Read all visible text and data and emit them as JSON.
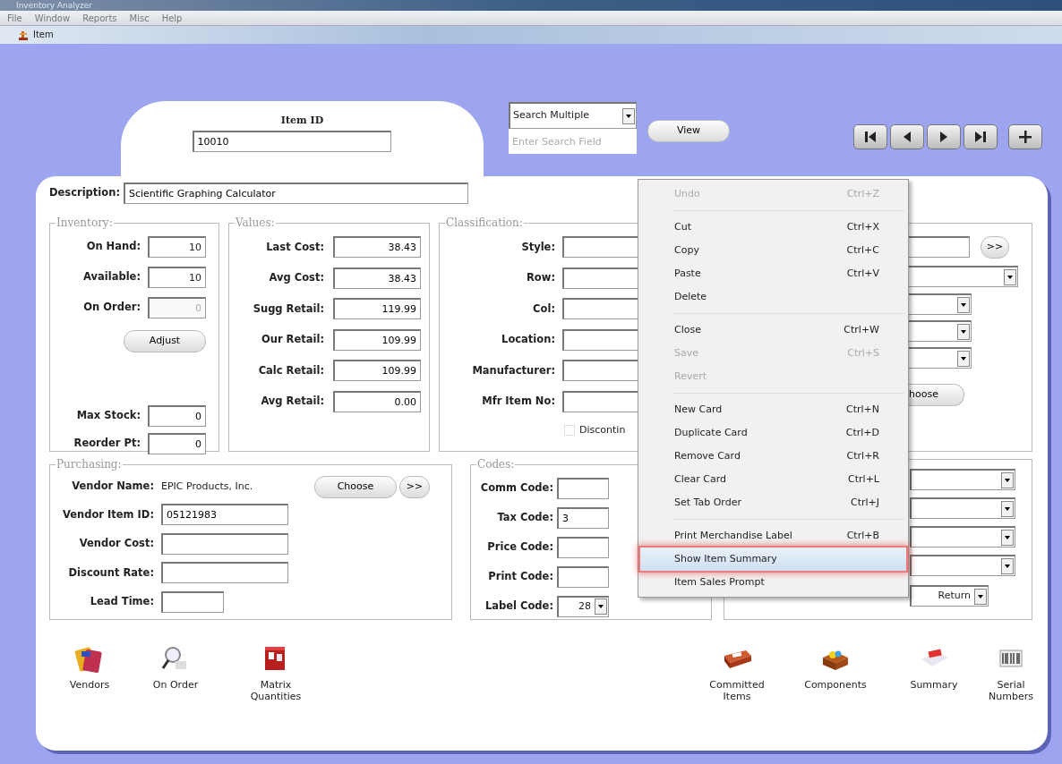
{
  "app_window": {
    "title": "Inventory Analyzer"
  },
  "menu_bar": [
    "File",
    "Window",
    "Reports",
    "Misc",
    "Help"
  ],
  "item_window": {
    "title": "Item"
  },
  "item_id": {
    "label": "Item ID",
    "value": "10010"
  },
  "search": {
    "mode": "Search Multiple",
    "placeholder": "Enter Search Field",
    "view_button": "View"
  },
  "description": {
    "label": "Description:",
    "value": "Scientific Graphing Calculator"
  },
  "inventory": {
    "title": "Inventory:",
    "fields": [
      {
        "label": "On Hand:",
        "value": "10",
        "disabled": false
      },
      {
        "label": "Available:",
        "value": "10",
        "disabled": false
      },
      {
        "label": "On Order:",
        "value": "0",
        "disabled": true
      }
    ],
    "adjust_button": "Adjust",
    "limits": [
      {
        "label": "Max Stock:",
        "value": "0"
      },
      {
        "label": "Reorder Pt:",
        "value": "0"
      }
    ]
  },
  "values": {
    "title": "Values:",
    "fields": [
      {
        "label": "Last Cost:",
        "value": "38.43"
      },
      {
        "label": "Avg Cost:",
        "value": "38.43"
      },
      {
        "label": "Sugg Retail:",
        "value": "119.99"
      },
      {
        "label": "Our Retail:",
        "value": "109.99"
      },
      {
        "label": "Calc Retail:",
        "value": "109.99"
      },
      {
        "label": "Avg Retail:",
        "value": "0.00"
      }
    ]
  },
  "classification": {
    "title": "Classification:",
    "fields": [
      {
        "label": "Style:"
      },
      {
        "label": "Row:"
      },
      {
        "label": "Col:"
      },
      {
        "label": "Location:"
      },
      {
        "label": "Manufacturer:"
      },
      {
        "label": "Mfr Item No:"
      }
    ],
    "discontinued": {
      "label": "Discontin",
      "checked": false
    },
    "side_controls": [
      {
        "kind": "text_more",
        "more_label": ">>"
      },
      {
        "kind": "select_wide"
      },
      {
        "kind": "select"
      },
      {
        "kind": "select"
      },
      {
        "kind": "select"
      },
      {
        "kind": "button",
        "label": "hoose"
      }
    ]
  },
  "purchasing": {
    "title": "Purchasing:",
    "vendor_name": {
      "label": "Vendor Name:",
      "value": "EPIC Products, Inc."
    },
    "choose_button": "Choose",
    "more_button": ">>",
    "fields": [
      {
        "label": "Vendor Item ID:",
        "value": "05121983",
        "kind": "text"
      },
      {
        "label": "Vendor Cost:",
        "kind": "text"
      },
      {
        "label": "Discount Rate:",
        "kind": "text"
      },
      {
        "label": "Lead Time:",
        "kind": "short"
      }
    ]
  },
  "codes": {
    "title": "Codes:",
    "fields": [
      {
        "label": "Comm Code:",
        "kind": "text"
      },
      {
        "label": "Tax Code:",
        "kind": "text",
        "value": "3"
      },
      {
        "label": "Price Code:",
        "kind": "text"
      },
      {
        "label": "Print Code:",
        "kind": "text"
      },
      {
        "label": "Label Code:",
        "kind": "select",
        "value": "28"
      }
    ]
  },
  "options": {
    "dropdowns": [
      {
        "kind": "select"
      },
      {
        "kind": "select"
      },
      {
        "kind": "select"
      },
      {
        "kind": "select"
      }
    ],
    "trans_code_value": "Return"
  },
  "tools_left": [
    {
      "label": "Vendors"
    },
    {
      "label": "On Order"
    },
    {
      "label": "Matrix Quantities"
    }
  ],
  "tools_right": [
    {
      "label": "Committed Items"
    },
    {
      "label": "Components"
    },
    {
      "label": "Summary"
    },
    {
      "label": "Serial Numbers"
    }
  ],
  "context_menu": {
    "items": [
      {
        "kind": "item",
        "label": "Undo",
        "shortcut": "Ctrl+Z",
        "disabled": true,
        "selected": false
      },
      {
        "kind": "separator"
      },
      {
        "kind": "item",
        "label": "Cut",
        "shortcut": "Ctrl+X",
        "disabled": false,
        "selected": false
      },
      {
        "kind": "item",
        "label": "Copy",
        "shortcut": "Ctrl+C",
        "disabled": false,
        "selected": false
      },
      {
        "kind": "item",
        "label": "Paste",
        "shortcut": "Ctrl+V",
        "disabled": false,
        "selected": false
      },
      {
        "kind": "item",
        "label": "Delete",
        "disabled": false,
        "selected": false
      },
      {
        "kind": "separator"
      },
      {
        "kind": "item",
        "label": "Close",
        "shortcut": "Ctrl+W",
        "disabled": false,
        "selected": false
      },
      {
        "kind": "item",
        "label": "Save",
        "shortcut": "Ctrl+S",
        "disabled": true,
        "selected": false
      },
      {
        "kind": "item",
        "label": "Revert",
        "disabled": true,
        "selected": false
      },
      {
        "kind": "separator"
      },
      {
        "kind": "item",
        "label": "New Card",
        "shortcut": "Ctrl+N",
        "disabled": false,
        "selected": false
      },
      {
        "kind": "item",
        "label": "Duplicate Card",
        "shortcut": "Ctrl+D",
        "disabled": false,
        "selected": false
      },
      {
        "kind": "item",
        "label": "Remove Card",
        "shortcut": "Ctrl+R",
        "disabled": false,
        "selected": false
      },
      {
        "kind": "item",
        "label": "Clear Card",
        "shortcut": "Ctrl+L",
        "disabled": false,
        "selected": false
      },
      {
        "kind": "item",
        "label": "Set Tab Order",
        "shortcut": "Ctrl+J",
        "disabled": false,
        "selected": false
      },
      {
        "kind": "separator"
      },
      {
        "kind": "item",
        "label": "Print Merchandise Label",
        "shortcut": "Ctrl+B",
        "disabled": false,
        "selected": false
      },
      {
        "kind": "item",
        "label": "Show Item Summary",
        "disabled": false,
        "selected": true
      },
      {
        "kind": "item",
        "label": "Item Sales Prompt",
        "disabled": false,
        "selected": false
      }
    ]
  }
}
